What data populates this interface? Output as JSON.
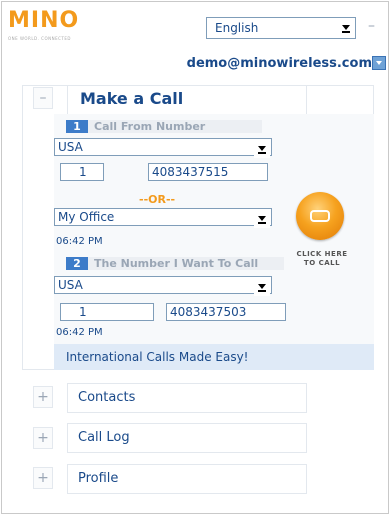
{
  "brand": {
    "logo_text": "MINO",
    "tagline": "ONE WORLD. CONNECTED"
  },
  "header": {
    "language": "English",
    "account_email": "demo@minowireless.com",
    "minimize_symbol": "–"
  },
  "make_call": {
    "title": "Make a Call",
    "toggle_symbol": "–",
    "from": {
      "step": "1",
      "label": "Call From Number",
      "country": "USA",
      "country_code": "1",
      "number": "4083437515"
    },
    "or_text": "--OR--",
    "location": {
      "value": "My Office",
      "time": "06:42 PM"
    },
    "to": {
      "step": "2",
      "label": "The Number I Want To Call",
      "country": "USA",
      "country_code": "1",
      "number": "4083437503",
      "time": "06:42 PM"
    },
    "call_button_label_line1": "CLICK HERE",
    "call_button_label_line2": "TO CALL",
    "banner": "International Calls Made Easy!"
  },
  "sections": [
    {
      "label": "Contacts",
      "toggle_symbol": "+"
    },
    {
      "label": "Call Log",
      "toggle_symbol": "+"
    },
    {
      "label": "Profile",
      "toggle_symbol": "+"
    }
  ],
  "colors": {
    "brand_orange": "#f39a1c",
    "link_blue": "#1a4a8a",
    "step_blue": "#3d7cc9",
    "banner_bg": "#dfeaf7"
  }
}
